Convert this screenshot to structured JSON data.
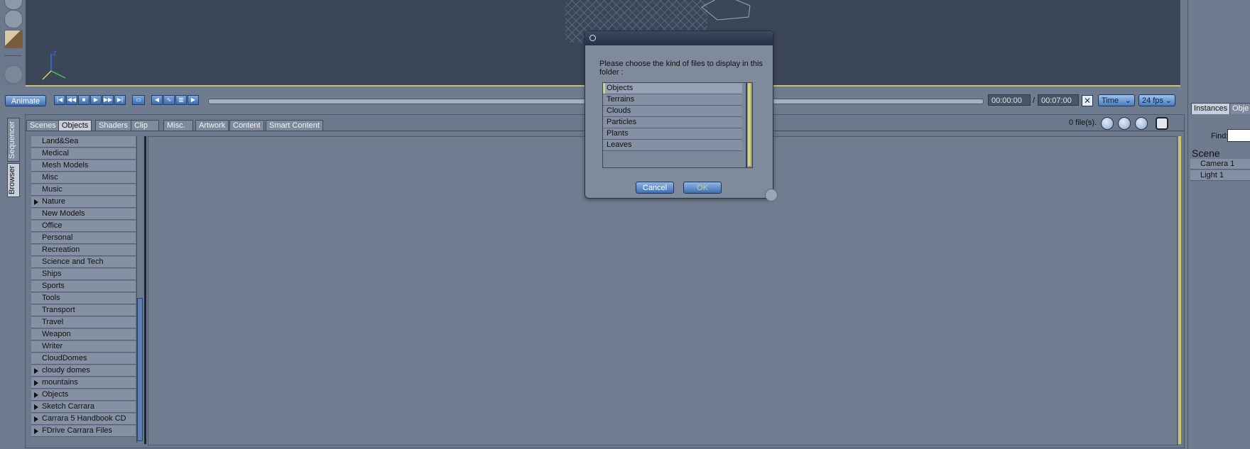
{
  "animbar": {
    "animate_label": "Animate",
    "current_time": "00:00:00",
    "separator": "/",
    "end_time": "00:07:00",
    "time_mode": "Time",
    "fps": "24 fps"
  },
  "browser": {
    "tabs": [
      "Scenes",
      "Objects",
      "Shaders",
      "Clip",
      "Misc.",
      "Artwork",
      "Content",
      "Smart Content"
    ],
    "active_tab": "Objects",
    "file_count": "0 file(s).",
    "side_tabs": [
      "Sequencer",
      "Browser"
    ],
    "folders": [
      {
        "label": "Land&Sea",
        "expandable": false
      },
      {
        "label": "Medical",
        "expandable": false
      },
      {
        "label": "Mesh Models",
        "expandable": false
      },
      {
        "label": "Misc",
        "expandable": false
      },
      {
        "label": "Music",
        "expandable": false
      },
      {
        "label": "Nature",
        "expandable": true
      },
      {
        "label": "New Models",
        "expandable": false
      },
      {
        "label": "Office",
        "expandable": false
      },
      {
        "label": "Personal",
        "expandable": false
      },
      {
        "label": "Recreation",
        "expandable": false
      },
      {
        "label": "Science and Tech",
        "expandable": false
      },
      {
        "label": "Ships",
        "expandable": false
      },
      {
        "label": "Sports",
        "expandable": false
      },
      {
        "label": "Tools",
        "expandable": false
      },
      {
        "label": "Transport",
        "expandable": false
      },
      {
        "label": "Travel",
        "expandable": false
      },
      {
        "label": "Weapon",
        "expandable": false
      },
      {
        "label": "Writer",
        "expandable": false
      },
      {
        "label": "CloudDomes",
        "expandable": false
      },
      {
        "label": "cloudy domes",
        "expandable": true
      },
      {
        "label": "mountains",
        "expandable": true
      },
      {
        "label": "Objects",
        "expandable": true
      },
      {
        "label": "Sketch Carrara",
        "expandable": true
      },
      {
        "label": "Carrara 5 Handbook CD",
        "expandable": true
      },
      {
        "label": "FDrive Carrara Files",
        "expandable": true
      }
    ]
  },
  "rightpanel": {
    "tabs": [
      "Instances",
      "Obje"
    ],
    "find_label": "Find:",
    "scene_label": "Scene",
    "scene_items": [
      "Camera 1",
      "Light 1"
    ]
  },
  "dialog": {
    "prompt": "Please choose the kind of files to display in this folder :",
    "options": [
      "Objects",
      "Terrains",
      "Clouds",
      "Particles",
      "Plants",
      "Leaves"
    ],
    "selected_option": "Objects",
    "cancel_label": "Cancel",
    "ok_label": "OK"
  },
  "colors": {
    "panel_bg": "#6f7b8e",
    "viewport_bg": "#3b4659",
    "accent_blue": "#4a7bbd",
    "highlight_yellow": "#d8d36a"
  }
}
